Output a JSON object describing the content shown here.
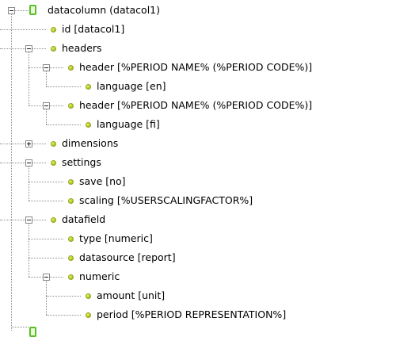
{
  "tree": {
    "nodes": [
      {
        "id": "root",
        "label": "datacolumn (datacol1)",
        "expanded": true
      },
      {
        "id": "id",
        "label": "id [datacol1]"
      },
      {
        "id": "headers",
        "label": "headers",
        "expanded": true
      },
      {
        "id": "header1",
        "label": "header [%PERIOD NAME% (%PERIOD CODE%)]",
        "expanded": true
      },
      {
        "id": "language1",
        "label": "language [en]"
      },
      {
        "id": "header2",
        "label": "header [%PERIOD NAME%  (%PERIOD CODE%)]",
        "expanded": true
      },
      {
        "id": "language2",
        "label": "language [fi]"
      },
      {
        "id": "dimensions",
        "label": "dimensions",
        "expanded": false
      },
      {
        "id": "settings",
        "label": "settings",
        "expanded": true
      },
      {
        "id": "save",
        "label": "save [no]"
      },
      {
        "id": "scaling",
        "label": "scaling [%USERSCALINGFACTOR%]"
      },
      {
        "id": "datafield",
        "label": "datafield",
        "expanded": true
      },
      {
        "id": "type",
        "label": "type [numeric]"
      },
      {
        "id": "datasource",
        "label": "datasource [report]"
      },
      {
        "id": "numeric",
        "label": "numeric",
        "expanded": true
      },
      {
        "id": "amount",
        "label": "amount [unit]"
      },
      {
        "id": "period",
        "label": "period [%PERIOD REPRESENTATION%]"
      }
    ]
  }
}
